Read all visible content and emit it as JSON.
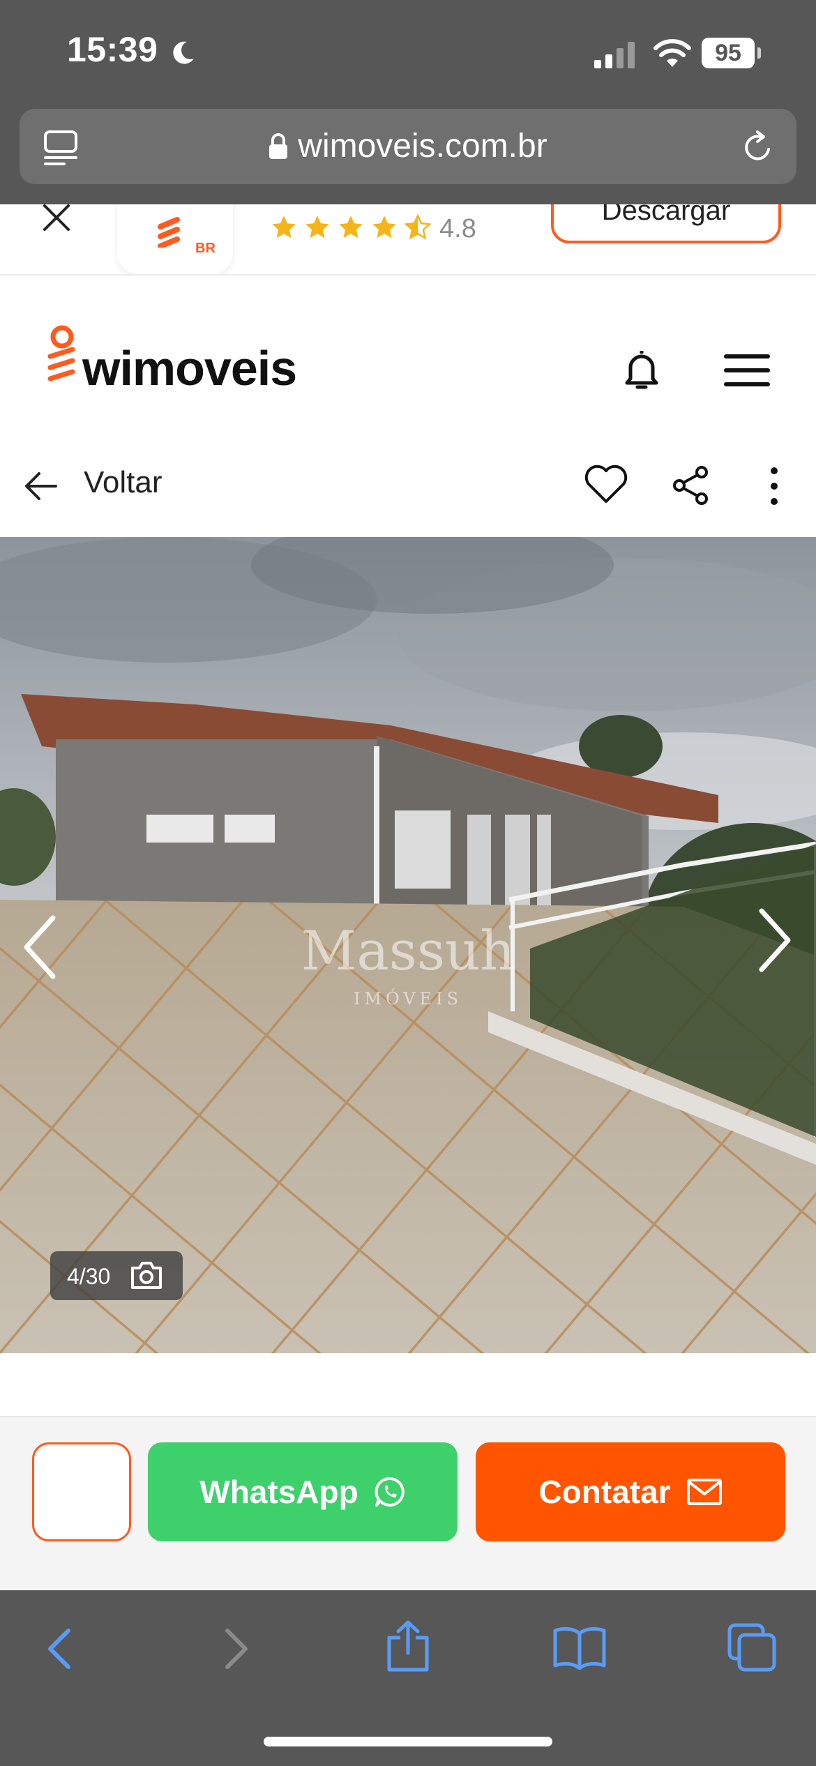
{
  "status_bar": {
    "time": "15:39",
    "battery": "95"
  },
  "browser": {
    "url": "wimoveis.com.br"
  },
  "app_banner": {
    "rating": "4.8",
    "logo_badge": "BR",
    "download_label": "Descargar"
  },
  "site_header": {
    "logo_text": "wimoveis"
  },
  "nav_bar": {
    "back_label": "Voltar"
  },
  "gallery": {
    "counter": "4/30",
    "watermark_title": "Massuh",
    "watermark_subtitle": "IMÓVEIS"
  },
  "cta": {
    "whatsapp_label": "WhatsApp",
    "contact_label": "Contatar"
  },
  "colors": {
    "brand_orange": "#ff5a1f",
    "whatsapp_green": "#3dd06b",
    "contact_orange": "#ff5400",
    "safari_gray": "#575757",
    "safari_blue": "#5a9cf5"
  },
  "icons": [
    "moon-icon",
    "signal-icon",
    "wifi-icon",
    "tabs-overview-icon",
    "lock-icon",
    "reload-icon",
    "close-icon",
    "star-icon",
    "bell-icon",
    "hamburger-icon",
    "back-arrow-icon",
    "heart-icon",
    "share-icon",
    "more-vertical-icon",
    "chevron-left-icon",
    "chevron-right-icon",
    "camera-icon",
    "whatsapp-icon",
    "mail-icon",
    "share-upload-icon",
    "bookmarks-icon",
    "tabs-icon"
  ]
}
